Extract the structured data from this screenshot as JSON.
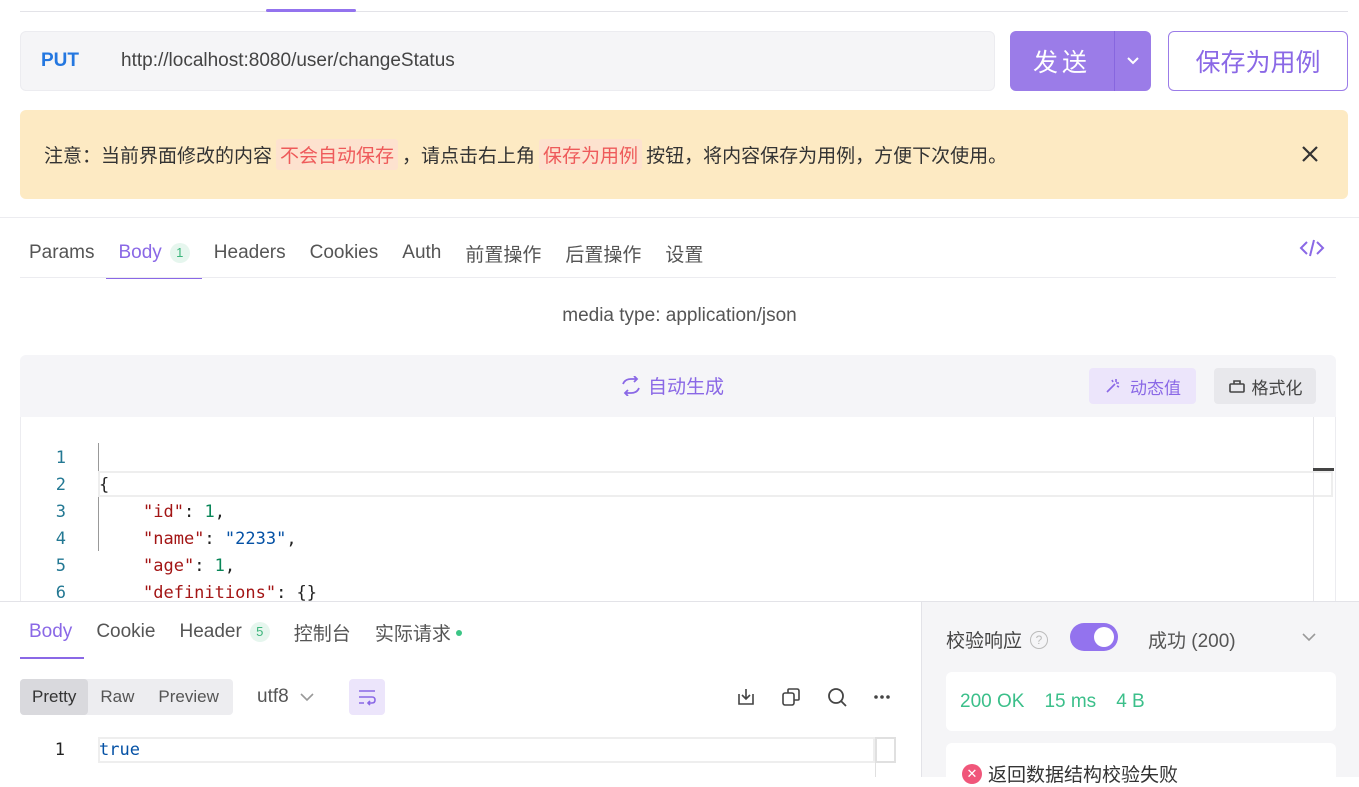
{
  "request": {
    "method": "PUT",
    "url": "http://localhost:8080/user/changeStatus",
    "send_label": "发送",
    "save_label": "保存为用例"
  },
  "notice": {
    "prefix": "注意：当前界面修改的内容",
    "hl1": "不会自动保存",
    "mid": "，请点击右上角",
    "hl2": "保存为用例",
    "suffix": "按钮，将内容保存为用例，方便下次使用。"
  },
  "tabs": [
    {
      "label": "Params"
    },
    {
      "label": "Body",
      "badge": "1"
    },
    {
      "label": "Headers"
    },
    {
      "label": "Cookies"
    },
    {
      "label": "Auth"
    },
    {
      "label": "前置操作"
    },
    {
      "label": "后置操作"
    },
    {
      "label": "设置"
    }
  ],
  "media_type": "media type: application/json",
  "editor": {
    "autogen_label": "自动生成",
    "dynamic_label": "动态值",
    "format_label": "格式化",
    "lines": [
      {
        "num": "1",
        "text": "{"
      },
      {
        "num": "2",
        "key": "\"id\"",
        "val": "1",
        "valtype": "n",
        "trail": ","
      },
      {
        "num": "3",
        "key": "\"name\"",
        "val": "\"2233\"",
        "valtype": "s",
        "trail": ","
      },
      {
        "num": "4",
        "key": "\"age\"",
        "val": "1",
        "valtype": "n",
        "trail": ","
      },
      {
        "num": "5",
        "key": "\"definitions\"",
        "val": "{}",
        "valtype": "p",
        "trail": ""
      },
      {
        "num": "6",
        "text": "}"
      }
    ]
  },
  "response": {
    "tabs": [
      {
        "label": "Body"
      },
      {
        "label": "Cookie"
      },
      {
        "label": "Header",
        "badge": "5"
      },
      {
        "label": "控制台"
      },
      {
        "label": "实际请求"
      }
    ],
    "views": [
      "Pretty",
      "Raw",
      "Preview"
    ],
    "encoding": "utf8",
    "line_num": "1",
    "body": "true"
  },
  "validation": {
    "label": "校验响应",
    "result": "成功 (200)",
    "status": "200 OK",
    "time": "15 ms",
    "size": "4 B",
    "error": "返回数据结构校验失败"
  },
  "colors": {
    "accent": "#8a68e6",
    "method": "#2477e0",
    "success": "#3bbf8a",
    "danger": "#ee5a5a"
  }
}
